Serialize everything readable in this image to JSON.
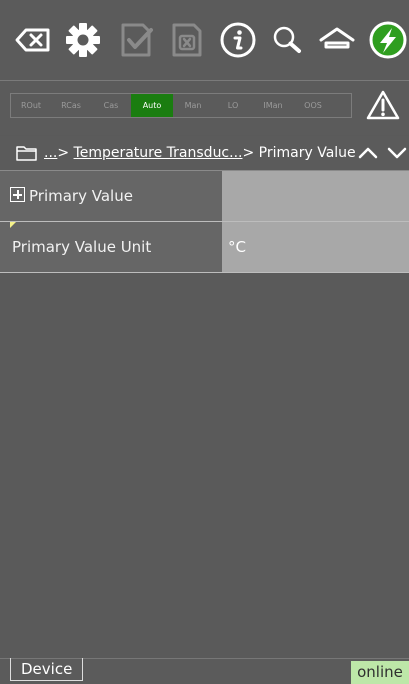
{
  "toolbar": {
    "icons": [
      "backspace-icon",
      "gear-icon",
      "checkmark-document-icon",
      "close-document-icon",
      "info-icon",
      "search-icon",
      "home-icon",
      "connect-icon"
    ]
  },
  "modes": {
    "items": [
      "ROut",
      "RCas",
      "Cas",
      "Auto",
      "Man",
      "LO",
      "IMan",
      "OOS"
    ],
    "active": "Auto",
    "active_color": "#1a7d10"
  },
  "breadcrumb": {
    "prefix": "...",
    "sep1": "> ",
    "link": "Temperature Transduc...",
    "sep2": "> ",
    "current": "Primary Value"
  },
  "rows": [
    {
      "label": "Primary Value",
      "value": ""
    },
    {
      "label": "Primary Value Unit",
      "value": "°C"
    }
  ],
  "status": {
    "tab": "Device",
    "connection": "online",
    "connection_color": "#bde7a8"
  }
}
